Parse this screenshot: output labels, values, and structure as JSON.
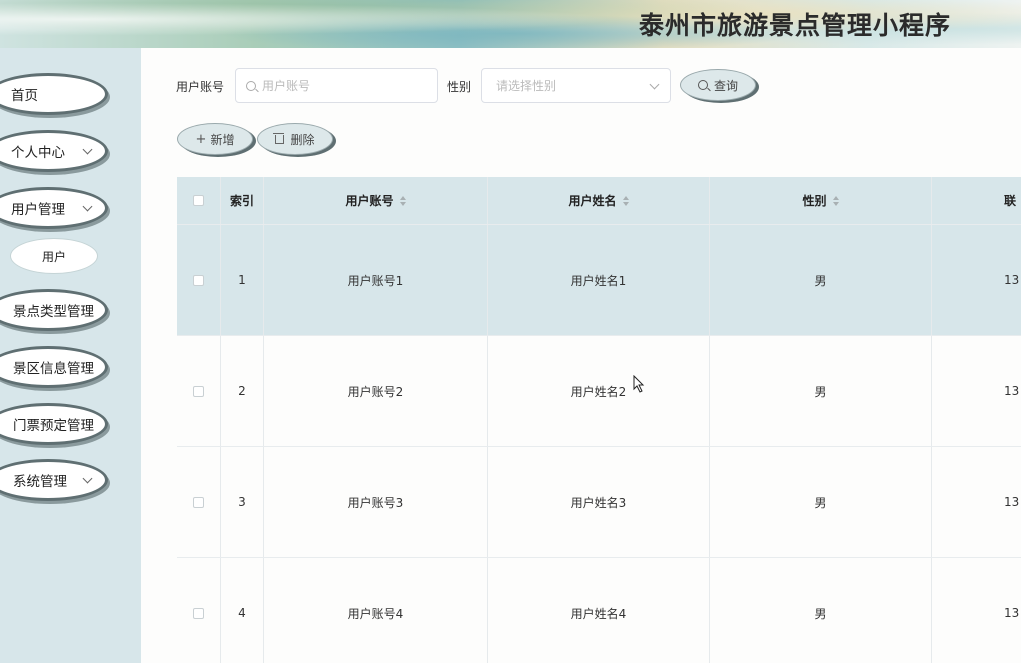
{
  "header": {
    "title": "泰州市旅游景点管理小程序"
  },
  "sidebar": {
    "items": [
      {
        "label": "首页",
        "has_chevron": false
      },
      {
        "label": "个人中心",
        "has_chevron": true
      },
      {
        "label": "用户管理",
        "has_chevron": true
      },
      {
        "label": "景点类型管理",
        "has_chevron": false
      },
      {
        "label": "景区信息管理",
        "has_chevron": false
      },
      {
        "label": "门票预定管理",
        "has_chevron": false
      },
      {
        "label": "系统管理",
        "has_chevron": true
      }
    ],
    "sub_item": {
      "label": "用户"
    }
  },
  "search": {
    "account_label": "用户账号",
    "account_placeholder": "用户账号",
    "gender_label": "性别",
    "gender_placeholder": "请选择性别",
    "query_button": "查询"
  },
  "toolbar": {
    "add_label": "新增",
    "delete_label": "删除"
  },
  "table": {
    "columns": [
      "索引",
      "用户账号",
      "用户姓名",
      "性别",
      "联"
    ],
    "rows": [
      {
        "index": "1",
        "account": "用户账号1",
        "name": "用户姓名1",
        "gender": "男",
        "phone": "13"
      },
      {
        "index": "2",
        "account": "用户账号2",
        "name": "用户姓名2",
        "gender": "男",
        "phone": "13"
      },
      {
        "index": "3",
        "account": "用户账号3",
        "name": "用户姓名3",
        "gender": "男",
        "phone": "13"
      },
      {
        "index": "4",
        "account": "用户账号4",
        "name": "用户姓名4",
        "gender": "男",
        "phone": "13"
      }
    ]
  },
  "colors": {
    "accent": "#d7e6ea",
    "pill_border": "#5f6f72"
  }
}
